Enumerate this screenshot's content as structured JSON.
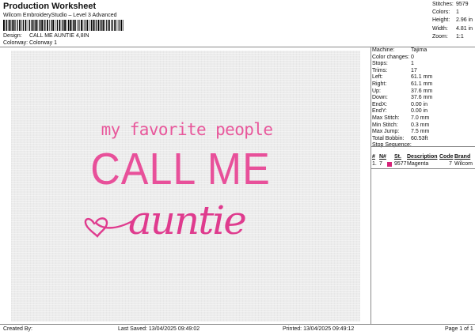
{
  "header": {
    "title": "Production Worksheet",
    "software": "Wilcom EmbroideryStudio – Level 3 Advanced",
    "design_label": "Design:",
    "design_value": "CALL ME AUNTIE 4,8IN",
    "colorway_label": "Colorway:",
    "colorway_value": "Colorway 1"
  },
  "summary": [
    {
      "label": "Stitches:",
      "value": "9579"
    },
    {
      "label": "Colors:",
      "value": "1"
    },
    {
      "label": "Height:",
      "value": "2.96 in"
    },
    {
      "label": "Width:",
      "value": "4.81 in"
    },
    {
      "label": "Zoom:",
      "value": "1:1"
    }
  ],
  "artwork": {
    "line1": "my favorite people",
    "line2": "CALL ME",
    "line3": "auntie",
    "colors": {
      "thread": "#e8509a",
      "canvas": "#ececec"
    }
  },
  "details": [
    {
      "label": "Machine:",
      "value": "Tajima"
    },
    {
      "label": "Color changes:",
      "value": "0"
    },
    {
      "label": "Stops:",
      "value": "1"
    },
    {
      "label": "Trims:",
      "value": "17"
    },
    {
      "label": "Left:",
      "value": "61.1 mm"
    },
    {
      "label": "Right:",
      "value": "61.1 mm"
    },
    {
      "label": "Up:",
      "value": "37.6 mm"
    },
    {
      "label": "Down:",
      "value": "37.6 mm"
    },
    {
      "label": "EndX:",
      "value": "0.00 in"
    },
    {
      "label": "EndY:",
      "value": "0.00 in"
    },
    {
      "label": "Max Stitch:",
      "value": "7.0 mm"
    },
    {
      "label": "Min Stitch:",
      "value": "0.3 mm"
    },
    {
      "label": "Max Jump:",
      "value": "7.5 mm"
    },
    {
      "label": "Total Bobbin:",
      "value": "60.53ft"
    }
  ],
  "stop_sequence": {
    "title": "Stop Sequence:",
    "columns": [
      "#",
      "N#",
      "St.",
      "Description",
      "Code",
      "Brand"
    ],
    "rows": [
      {
        "index": "1.",
        "needle": "7",
        "stitches": "9577",
        "description": "Magenta",
        "code": "7",
        "brand": "Wilcom",
        "color": "#d6247a"
      }
    ]
  },
  "footer": {
    "created_by": "Created By:",
    "last_saved": "Last Saved: 13/04/2025 09:49:02",
    "printed": "Printed: 13/04/2025 09:49:12",
    "page": "Page 1 of 1"
  }
}
